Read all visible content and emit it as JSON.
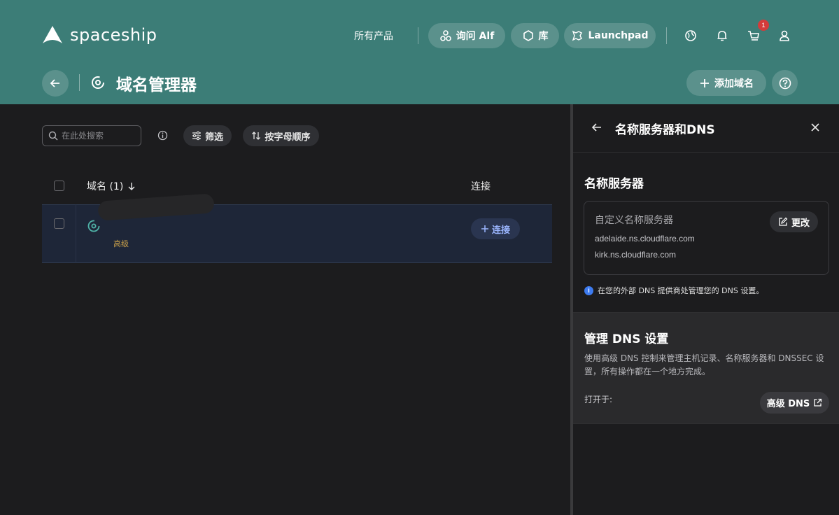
{
  "header": {
    "brand": "spaceship",
    "nav_products": "所有产品",
    "ask_alf": "询问 Alf",
    "library": "库",
    "launchpad": "Launchpad",
    "cart_count": "1",
    "page_title": "域名管理器",
    "add_domain": "添加域名"
  },
  "toolbar": {
    "search_placeholder": "在此处搜索",
    "filter": "筛选",
    "sort": "按字母顺序"
  },
  "table": {
    "col_domain": "域名 (1)",
    "col_connect": "连接",
    "rows": [
      {
        "tier": "高级",
        "connect_label": "连接"
      }
    ]
  },
  "panel": {
    "title": "名称服务器和DNS",
    "ns_heading": "名称服务器",
    "ns_card_label": "自定义名称服务器",
    "edit": "更改",
    "nameservers": [
      "adelaide.ns.cloudflare.com",
      "kirk.ns.cloudflare.com"
    ],
    "note": "在您的外部 DNS 提供商处管理您的 DNS 设置。",
    "dns_heading": "管理 DNS 设置",
    "dns_desc": "使用高级 DNS 控制来管理主机记录、名称服务器和 DNSSEC 设置，所有操作都在一个地方完成。",
    "open_in": "打开于:",
    "advanced_dns": "高级 DNS"
  },
  "colors": {
    "header_bg": "#3c7d77",
    "body_bg": "#1c1c1e",
    "row_selected": "#1e2638",
    "badge": "#d33b3b",
    "info": "#3d7bf0"
  }
}
